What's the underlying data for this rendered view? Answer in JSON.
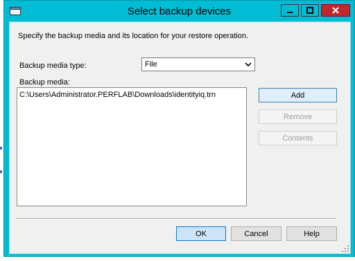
{
  "window": {
    "title": "Select backup devices",
    "accent_color": "#00bcd4",
    "close_color": "#c1272d"
  },
  "dialog": {
    "intro": "Specify the backup media and its location for your restore operation.",
    "media_type_label": "Backup media type:",
    "media_type_value": "File",
    "media_label": "Backup media:",
    "media_items": [
      "C:\\Users\\Administrator.PERFLAB\\Downloads\\identityiq.trn"
    ]
  },
  "buttons": {
    "add": "Add",
    "remove": "Remove",
    "contents": "Contents",
    "ok": "OK",
    "cancel": "Cancel",
    "help": "Help"
  }
}
